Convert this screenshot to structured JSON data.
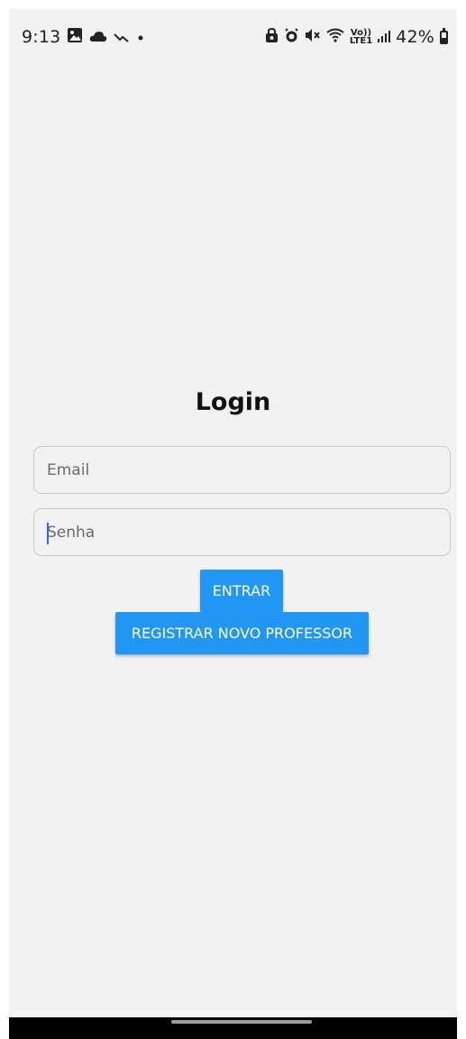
{
  "status_bar": {
    "time": "9:13",
    "left_icons": [
      "gallery-icon",
      "cloud-icon",
      "trend-icon",
      "dot-icon"
    ],
    "right_icons": [
      "lock-icon",
      "alarm-icon",
      "mute-icon",
      "wifi-icon"
    ],
    "volte_top": "Vo))",
    "volte_bottom": "LTE1",
    "battery_percent": "42%",
    "battery_level": 0.42
  },
  "login": {
    "title": "Login",
    "email_placeholder": "Email",
    "password_placeholder": "Senha",
    "enter_button": "ENTRAR",
    "register_button": "REGISTRAR NOVO PROFESSOR"
  },
  "colors": {
    "accent": "#2196f3",
    "background": "#f2f2f2"
  }
}
